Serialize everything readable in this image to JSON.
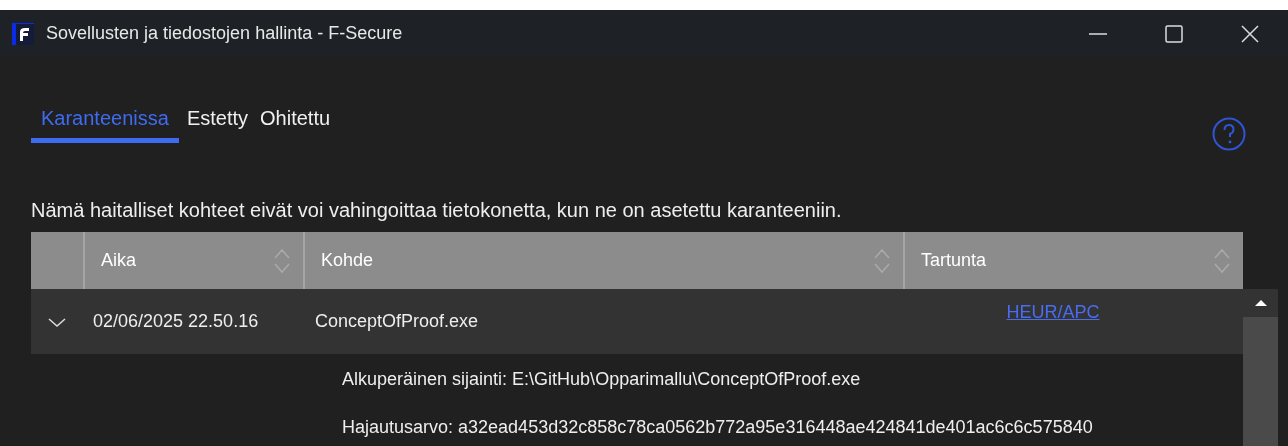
{
  "window": {
    "title": "Sovellusten ja tiedostojen hallinta - F-Secure"
  },
  "tabs": [
    {
      "label": "Karanteenissa",
      "selected": true
    },
    {
      "label": "Estetty",
      "selected": false
    },
    {
      "label": "Ohitettu",
      "selected": false
    }
  ],
  "description": "Nämä haitalliset kohteet eivät voi vahingoittaa tietokonetta, kun ne on asetettu karanteeniin.",
  "table": {
    "columns": [
      {
        "label": "Aika"
      },
      {
        "label": "Kohde"
      },
      {
        "label": "Tartunta"
      }
    ],
    "rows": [
      {
        "expanded": true,
        "time": "02/06/2025 22.50.16",
        "item": "ConceptOfProof.exe",
        "infection": "HEUR/APC",
        "details": [
          "Alkuperäinen sijainti: E:\\GitHub\\Opparimallu\\ConceptOfProof.exe",
          "Hajautusarvo: a32ead453d32c858c78ca0562b772a95e316448ae424841de401ac6c6c575840"
        ]
      }
    ]
  }
}
